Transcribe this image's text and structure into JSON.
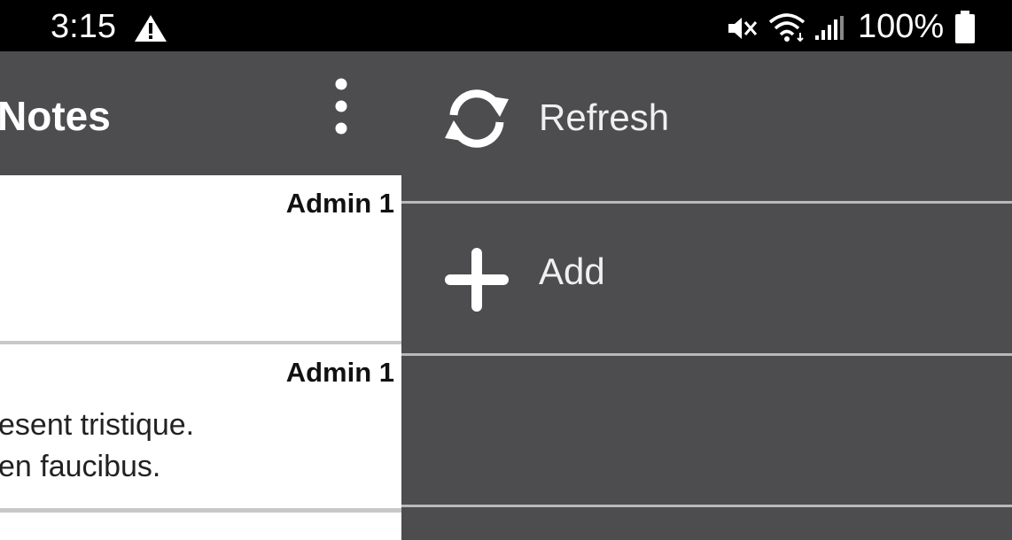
{
  "status_bar": {
    "time": "3:15",
    "battery": "100%",
    "icons": [
      "warning-icon",
      "mute-icon",
      "wifi-icon",
      "signal-icon",
      "battery-icon"
    ]
  },
  "app_bar": {
    "title": "Notes",
    "menu_icon": "more-vert-icon"
  },
  "notes": [
    {
      "author": "Admin 1",
      "body_lines": []
    },
    {
      "author": "Admin 1",
      "body_lines": [
        "esent tristique.",
        "en faucibus."
      ]
    }
  ],
  "menu": {
    "items": [
      {
        "label": "Refresh",
        "icon": "refresh-icon"
      },
      {
        "label": "Add",
        "icon": "add-icon"
      }
    ]
  },
  "colors": {
    "status_bar": "#000000",
    "background": "#4d4d4f",
    "card": "#ffffff",
    "divider": "#b9b9b9",
    "text_light": "#f0f0f0"
  }
}
